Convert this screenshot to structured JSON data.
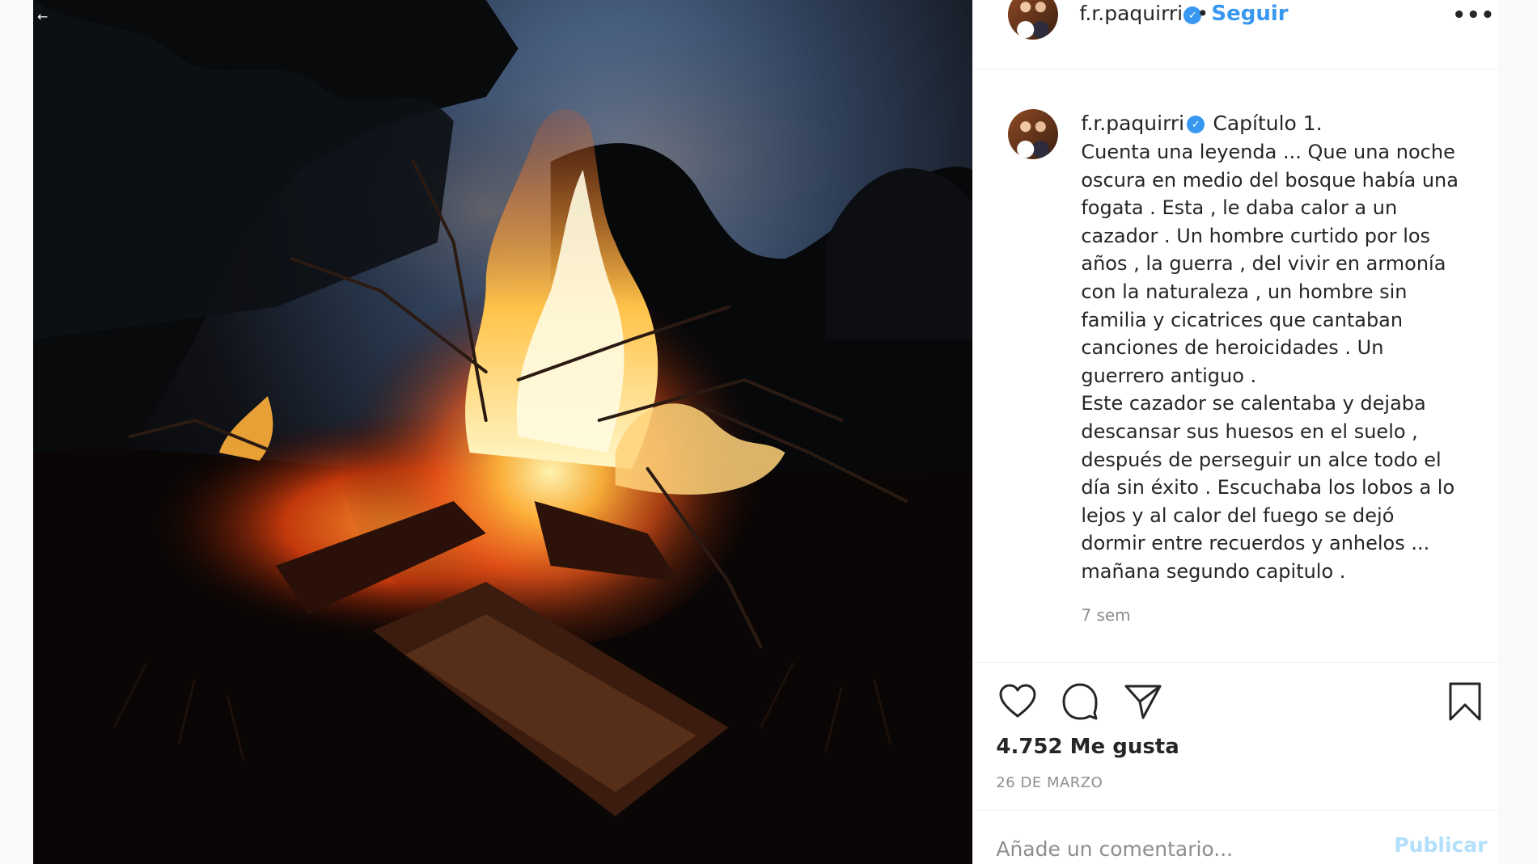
{
  "photo": {
    "alt": "",
    "corner_glyph": "←"
  },
  "header": {
    "username": "f.r.paquirri",
    "separator": "•",
    "follow_label": "Seguir",
    "more_icon": "more-horizontal-icon",
    "more_glyph": "•••"
  },
  "caption": {
    "username": "f.r.paquirri",
    "title": "Capítulo 1.",
    "body": "Cuenta una leyenda ... Que una noche oscura en medio del bosque había una fogata . Esta , le daba calor a un cazador . Un hombre curtido por los años , la guerra , del vivir en armonía con la naturaleza , un hombre sin familia y cicatrices que cantaban canciones de heroicidades . Un guerrero antiguo .\nEste cazador se calentaba y dejaba descansar sus huesos en el suelo , después de perseguir un alce todo el día sin éxito . Escuchaba los lobos a lo lejos y al calor del fuego se dejó dormir entre recuerdos y anhelos ... mañana segundo capitulo .",
    "time_ago": "7 sem"
  },
  "actions": {
    "icons": [
      "heart-icon",
      "comment-icon",
      "share-icon",
      "bookmark-icon"
    ],
    "likes_text": "4.752 Me gusta",
    "date": "26 DE MARZO"
  },
  "comment_bar": {
    "placeholder": "Añade un comentario...",
    "value": "",
    "publish_label": "Publicar"
  },
  "colors": {
    "link_blue": "#3897f0",
    "publish_disabled": "#b2dffc",
    "muted": "#8e8e8e",
    "text": "#262626",
    "border": "#efefef"
  }
}
